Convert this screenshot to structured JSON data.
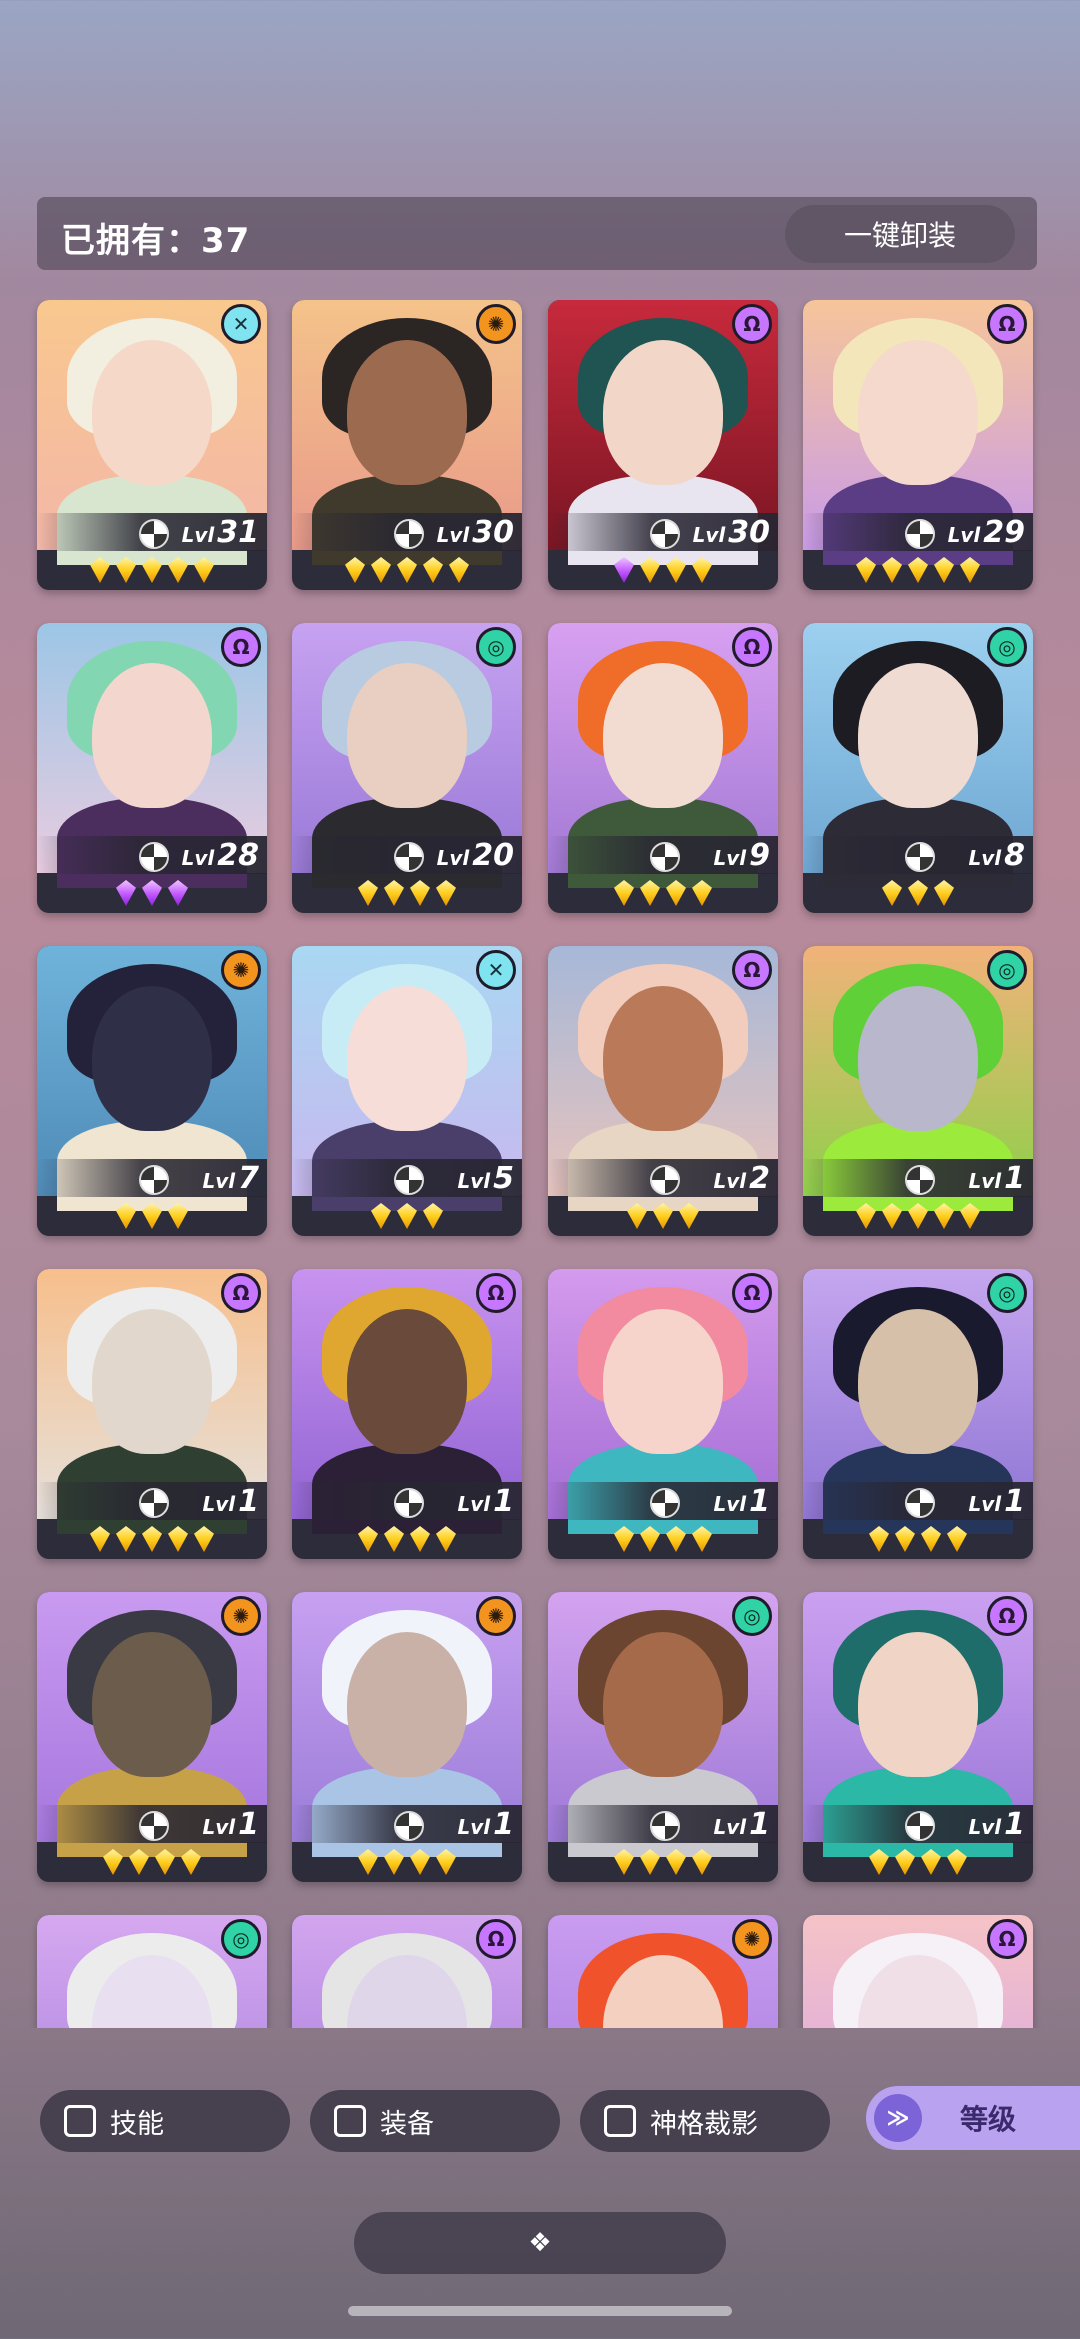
{
  "header": {
    "owned_label": "已拥有：37",
    "unequip_all": "一键卸装"
  },
  "colors": {
    "element_purple": "#c676ff",
    "element_orange": "#f2941d",
    "element_teal": "#2fd3a5",
    "element_cyan": "#7fe3f0",
    "star_gold": "#ffcf1f",
    "star_purple": "#c257ff",
    "accent": "#b9a2f0"
  },
  "level_label": "Lvl",
  "cards": [
    {
      "element": "cyan-x",
      "level": "31",
      "stars": 5,
      "star_color": "gold",
      "bg": [
        "#f9c88e",
        "#f3b7a8"
      ],
      "hair": "#f2efe0",
      "skin": "#f5d8c8",
      "cloth": "#d8e6d0"
    },
    {
      "element": "orange-sun",
      "level": "30",
      "stars": 5,
      "star_color": "gold",
      "bg": [
        "#f4c38a",
        "#e99a8a"
      ],
      "hair": "#2b2523",
      "skin": "#9c6a4f",
      "cloth": "#403a2d"
    },
    {
      "element": "purple-omega",
      "level": "30",
      "stars": 4,
      "star_color": "mixed",
      "bg": [
        "#c72a3c",
        "#7a1523"
      ],
      "hair": "#1f5452",
      "skin": "#f2d7c9",
      "cloth": "#e8e4f0"
    },
    {
      "element": "purple-omega",
      "level": "29",
      "stars": 5,
      "star_color": "gold",
      "bg": [
        "#f7c59a",
        "#c99be8"
      ],
      "hair": "#f3e6bb",
      "skin": "#f5d9cc",
      "cloth": "#5b3d86"
    },
    {
      "element": "purple-omega",
      "level": "28",
      "stars": 3,
      "star_color": "purple",
      "bg": [
        "#9cc6e6",
        "#e8cce0"
      ],
      "hair": "#82d6b1",
      "skin": "#f3d6cd",
      "cloth": "#4b2e5e"
    },
    {
      "element": "teal-swirl",
      "level": "20",
      "stars": 4,
      "star_color": "gold",
      "bg": [
        "#c7a2f1",
        "#9a7ad8"
      ],
      "hair": "#b8cbe0",
      "skin": "#e8cfc1",
      "cloth": "#2a2a2f"
    },
    {
      "element": "purple-omega",
      "level": "9",
      "stars": 4,
      "star_color": "gold",
      "bg": [
        "#d8a0f1",
        "#a37ad5"
      ],
      "hair": "#f06d29",
      "skin": "#f2dcd2",
      "cloth": "#3f5a3b"
    },
    {
      "element": "teal-swirl",
      "level": "8",
      "stars": 3,
      "star_color": "gold",
      "bg": [
        "#9dd0ef",
        "#6ea7d3"
      ],
      "hair": "#1c1c22",
      "skin": "#f0dbd2",
      "cloth": "#2c2b36"
    },
    {
      "element": "orange-sun",
      "level": "7",
      "stars": 3,
      "star_color": "gold",
      "bg": [
        "#6fb3da",
        "#4f8bb8"
      ],
      "hair": "#23223a",
      "skin": "#302f48",
      "cloth": "#efe5d0"
    },
    {
      "element": "cyan-x",
      "level": "5",
      "stars": 3,
      "star_color": "gold",
      "bg": [
        "#a9d8f2",
        "#c8b8ef"
      ],
      "hair": "#c8ecf5",
      "skin": "#f6ddd7",
      "cloth": "#4a3f6a"
    },
    {
      "element": "purple-omega",
      "level": "2",
      "stars": 3,
      "star_color": "gold",
      "bg": [
        "#a6b8d8",
        "#e6c3bd"
      ],
      "hair": "#f2cdbd",
      "skin": "#ba7a59",
      "cloth": "#e6d6c3"
    },
    {
      "element": "teal-swirl",
      "level": "1",
      "stars": 5,
      "star_color": "gold",
      "bg": [
        "#f2b27a",
        "#8fd04a"
      ],
      "hair": "#5fd038",
      "skin": "#b8b7cc",
      "cloth": "#9bea3c"
    },
    {
      "element": "purple-omega",
      "level": "1",
      "stars": 5,
      "star_color": "gold",
      "bg": [
        "#f7bf8c",
        "#e6e0da"
      ],
      "hair": "#ededed",
      "skin": "#e2d7cc",
      "cloth": "#2f3f32"
    },
    {
      "element": "purple-omega",
      "level": "1",
      "stars": 4,
      "star_color": "gold",
      "bg": [
        "#c893ef",
        "#9264d4"
      ],
      "hair": "#e0a730",
      "skin": "#6a4a3a",
      "cloth": "#2c2036"
    },
    {
      "element": "purple-omega",
      "level": "1",
      "stars": 4,
      "star_color": "gold",
      "bg": [
        "#d49aed",
        "#a46ed5"
      ],
      "hair": "#f28ba0",
      "skin": "#f6d4cc",
      "cloth": "#3fb7c0"
    },
    {
      "element": "teal-swirl",
      "level": "1",
      "stars": 4,
      "star_color": "gold",
      "bg": [
        "#c5a6ef",
        "#9076d5"
      ],
      "hair": "#1a1a2e",
      "skin": "#d7c0aa",
      "cloth": "#26365a"
    },
    {
      "element": "orange-sun",
      "level": "1",
      "stars": 4,
      "star_color": "gold",
      "bg": [
        "#c99af0",
        "#a677de"
      ],
      "hair": "#3a3a44",
      "skin": "#6c5c4c",
      "cloth": "#c6a148"
    },
    {
      "element": "orange-sun",
      "level": "1",
      "stars": 4,
      "star_color": "gold",
      "bg": [
        "#c7a0f1",
        "#9b7dd8"
      ],
      "hair": "#f0f4fa",
      "skin": "#c9b1a7",
      "cloth": "#aac4e6"
    },
    {
      "element": "teal-swirl",
      "level": "1",
      "stars": 4,
      "star_color": "gold",
      "bg": [
        "#d4a3f0",
        "#9d79d6"
      ],
      "hair": "#6b4530",
      "skin": "#a56a4a",
      "cloth": "#c9c9cf"
    },
    {
      "element": "purple-omega",
      "level": "1",
      "stars": 4,
      "star_color": "gold",
      "bg": [
        "#cba0f1",
        "#9b78d7"
      ],
      "hair": "#1f6d6a",
      "skin": "#f0d5c6",
      "cloth": "#2bb8a6"
    },
    {
      "element": "teal-swirl",
      "level": "",
      "stars": 0,
      "star_color": "gold",
      "bg": [
        "#d6a8f0",
        "#a680dc"
      ],
      "hair": "#ececec",
      "skin": "#e8e0f0",
      "cloth": "#ffffff"
    },
    {
      "element": "purple-omega",
      "level": "",
      "stars": 0,
      "star_color": "gold",
      "bg": [
        "#d3a5ef",
        "#a27bd9"
      ],
      "hair": "#e5e5e5",
      "skin": "#e0d6ea",
      "cloth": "#3a2a44"
    },
    {
      "element": "orange-sun",
      "level": "",
      "stars": 0,
      "star_color": "gold",
      "bg": [
        "#c99cf0",
        "#a47bdc"
      ],
      "hair": "#f0522c",
      "skin": "#f4d0c0",
      "cloth": "#3c2f40"
    },
    {
      "element": "purple-omega",
      "level": "",
      "stars": 0,
      "star_color": "gold",
      "bg": [
        "#f5c3c6",
        "#d6a3e6"
      ],
      "hair": "#f6f1f6",
      "skin": "#f0dfe6",
      "cloth": "#ffffff"
    }
  ],
  "filters": [
    {
      "label": "技能"
    },
    {
      "label": "装备"
    },
    {
      "label": "神格裁影"
    }
  ],
  "sort": {
    "label": "等级",
    "icon": "double-chevron-down-icon"
  },
  "handle_icon": "diamonds-icon"
}
